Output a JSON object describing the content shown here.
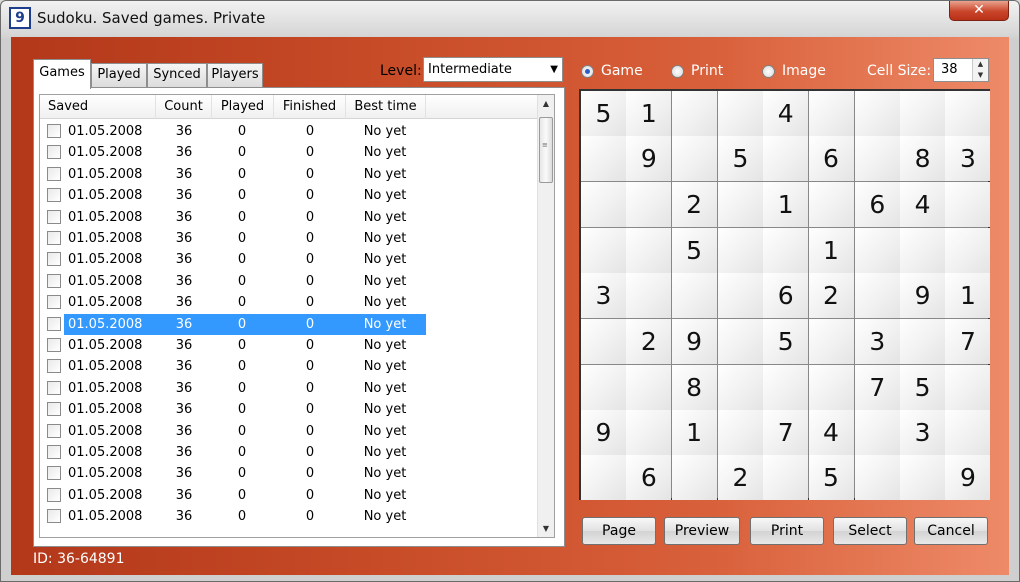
{
  "window": {
    "title": "Sudoku. Saved games. Private",
    "app_icon": "9",
    "close_label": "✕"
  },
  "tabs": [
    {
      "label": "Games",
      "active": true
    },
    {
      "label": "Played",
      "active": false
    },
    {
      "label": "Synced",
      "active": false
    },
    {
      "label": "Players",
      "active": false
    }
  ],
  "level": {
    "label": "Level:",
    "value": "Intermediate"
  },
  "table": {
    "headers": {
      "saved": "Saved",
      "count": "Count",
      "played": "Played",
      "finished": "Finished",
      "best": "Best time"
    },
    "selected_index": 9,
    "rows": [
      {
        "saved": "01.05.2008",
        "count": "36",
        "played": "0",
        "finished": "0",
        "best": "No yet"
      },
      {
        "saved": "01.05.2008",
        "count": "36",
        "played": "0",
        "finished": "0",
        "best": "No yet"
      },
      {
        "saved": "01.05.2008",
        "count": "36",
        "played": "0",
        "finished": "0",
        "best": "No yet"
      },
      {
        "saved": "01.05.2008",
        "count": "36",
        "played": "0",
        "finished": "0",
        "best": "No yet"
      },
      {
        "saved": "01.05.2008",
        "count": "36",
        "played": "0",
        "finished": "0",
        "best": "No yet"
      },
      {
        "saved": "01.05.2008",
        "count": "36",
        "played": "0",
        "finished": "0",
        "best": "No yet"
      },
      {
        "saved": "01.05.2008",
        "count": "36",
        "played": "0",
        "finished": "0",
        "best": "No yet"
      },
      {
        "saved": "01.05.2008",
        "count": "36",
        "played": "0",
        "finished": "0",
        "best": "No yet"
      },
      {
        "saved": "01.05.2008",
        "count": "36",
        "played": "0",
        "finished": "0",
        "best": "No yet"
      },
      {
        "saved": "01.05.2008",
        "count": "36",
        "played": "0",
        "finished": "0",
        "best": "No yet"
      },
      {
        "saved": "01.05.2008",
        "count": "36",
        "played": "0",
        "finished": "0",
        "best": "No yet"
      },
      {
        "saved": "01.05.2008",
        "count": "36",
        "played": "0",
        "finished": "0",
        "best": "No yet"
      },
      {
        "saved": "01.05.2008",
        "count": "36",
        "played": "0",
        "finished": "0",
        "best": "No yet"
      },
      {
        "saved": "01.05.2008",
        "count": "36",
        "played": "0",
        "finished": "0",
        "best": "No yet"
      },
      {
        "saved": "01.05.2008",
        "count": "36",
        "played": "0",
        "finished": "0",
        "best": "No yet"
      },
      {
        "saved": "01.05.2008",
        "count": "36",
        "played": "0",
        "finished": "0",
        "best": "No yet"
      },
      {
        "saved": "01.05.2008",
        "count": "36",
        "played": "0",
        "finished": "0",
        "best": "No yet"
      },
      {
        "saved": "01.05.2008",
        "count": "36",
        "played": "0",
        "finished": "0",
        "best": "No yet"
      },
      {
        "saved": "01.05.2008",
        "count": "36",
        "played": "0",
        "finished": "0",
        "best": "No yet"
      }
    ]
  },
  "view_modes": [
    {
      "label": "Game",
      "checked": true
    },
    {
      "label": "Print",
      "checked": false
    },
    {
      "label": "Image",
      "checked": false
    }
  ],
  "cell_size": {
    "label": "Cell Size:",
    "value": "38"
  },
  "board": [
    [
      "5",
      "1",
      "",
      "",
      "4",
      "",
      "",
      "",
      ""
    ],
    [
      "",
      "9",
      "",
      "5",
      "",
      "6",
      "",
      "8",
      "3"
    ],
    [
      "",
      "",
      "2",
      "",
      "1",
      "",
      "6",
      "4",
      ""
    ],
    [
      "",
      "",
      "5",
      "",
      "",
      "1",
      "",
      "",
      ""
    ],
    [
      "3",
      "",
      "",
      "",
      "6",
      "2",
      "",
      "9",
      "1"
    ],
    [
      "",
      "2",
      "9",
      "",
      "5",
      "",
      "3",
      "",
      "7"
    ],
    [
      "",
      "",
      "8",
      "",
      "",
      "",
      "7",
      "5",
      ""
    ],
    [
      "9",
      "",
      "1",
      "",
      "7",
      "4",
      "",
      "3",
      ""
    ],
    [
      "",
      "6",
      "",
      "2",
      "",
      "5",
      "",
      "",
      "9"
    ]
  ],
  "buttons": {
    "page": "Page",
    "preview": "Preview",
    "print": "Print",
    "select": "Select",
    "cancel": "Cancel"
  },
  "status": {
    "id_text": "ID: 36-64891"
  },
  "colors": {
    "frame_orange": "#c64a26",
    "selection_blue": "#3399ff"
  }
}
